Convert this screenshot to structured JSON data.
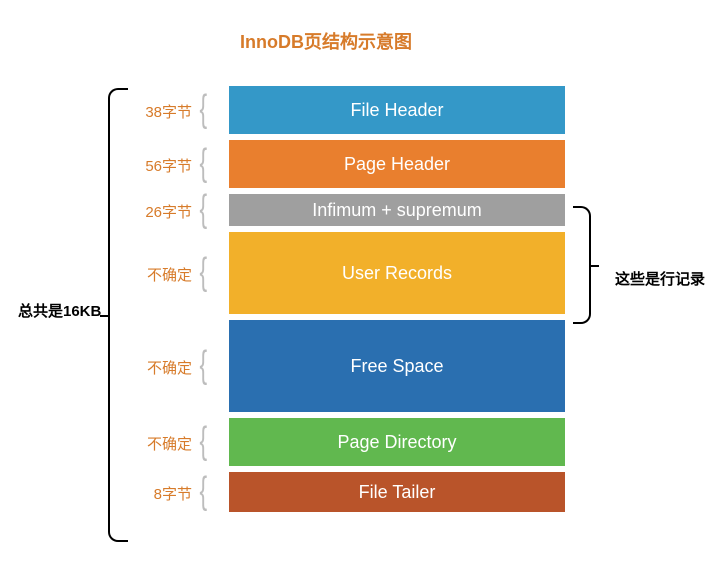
{
  "title": "InnoDB页结构示意图",
  "total_label": "总共是16KB",
  "row_records_label": "这些是行记录",
  "blocks": [
    {
      "name": "File Header",
      "size": "38字节",
      "color": "c-fileheader",
      "height": 48
    },
    {
      "name": "Page Header",
      "size": "56字节",
      "color": "c-pageheader",
      "height": 48
    },
    {
      "name": "Infimum + supremum",
      "size": "26字节",
      "color": "c-infsup",
      "height": 32
    },
    {
      "name": "User Records",
      "size": "不确定",
      "color": "c-userrec",
      "height": 82
    },
    {
      "name": "Free Space",
      "size": "不确定",
      "color": "c-freespace",
      "height": 92
    },
    {
      "name": "Page Directory",
      "size": "不确定",
      "color": "c-pagedir",
      "height": 48
    },
    {
      "name": "File Tailer",
      "size": "8字节",
      "color": "c-filetailer",
      "height": 40
    }
  ]
}
